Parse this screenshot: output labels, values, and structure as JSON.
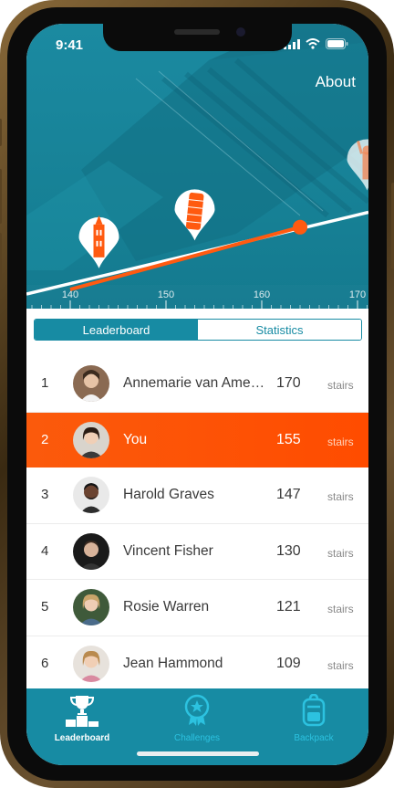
{
  "status_bar": {
    "time": "9:41"
  },
  "header": {
    "about_label": "About"
  },
  "chart_data": {
    "type": "line",
    "x_ticks": [
      140,
      150,
      160,
      170
    ],
    "line_start": 140,
    "progress_start": 140,
    "progress_end": 164,
    "landmarks": [
      {
        "icon": "tower-icon",
        "value": 143
      },
      {
        "icon": "leaning-tower-icon",
        "value": 153
      },
      {
        "icon": "statue-of-liberty-icon",
        "value": 171
      }
    ],
    "colors": {
      "progress": "#ff5a10",
      "line": "#ffffff"
    }
  },
  "tabs": [
    {
      "label": "Leaderboard",
      "active": true
    },
    {
      "label": "Statistics",
      "active": false
    }
  ],
  "leaderboard": [
    {
      "rank": "1",
      "name": "Annemarie van Ame…",
      "value": "170",
      "unit": "stairs"
    },
    {
      "rank": "2",
      "name": "You",
      "value": "155",
      "unit": "stairs",
      "me": true
    },
    {
      "rank": "3",
      "name": "Harold Graves",
      "value": "147",
      "unit": "stairs"
    },
    {
      "rank": "4",
      "name": "Vincent Fisher",
      "value": "130",
      "unit": "stairs"
    },
    {
      "rank": "5",
      "name": "Rosie Warren",
      "value": "121",
      "unit": "stairs"
    },
    {
      "rank": "6",
      "name": "Jean Hammond",
      "value": "109",
      "unit": "stairs"
    }
  ],
  "nav": [
    {
      "label": "Leaderboard",
      "icon": "trophy-podium-icon",
      "active": true
    },
    {
      "label": "Challenges",
      "icon": "medal-icon",
      "active": false
    },
    {
      "label": "Backpack",
      "icon": "backpack-icon",
      "active": false
    }
  ],
  "colors": {
    "accent": "#178ba3",
    "highlight": "#ff4c00"
  }
}
